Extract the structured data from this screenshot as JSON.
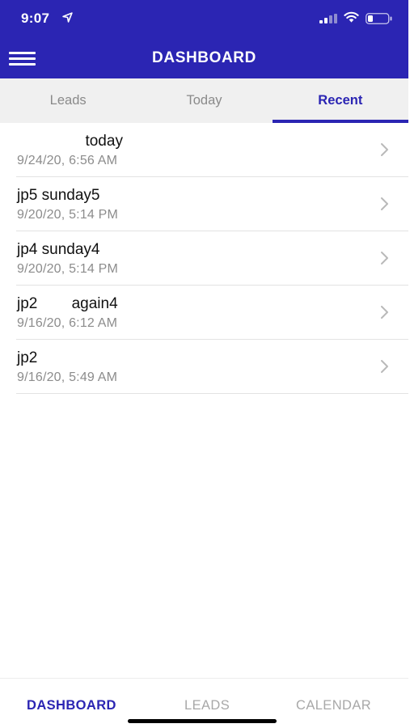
{
  "status_bar": {
    "time": "9:07",
    "icons": [
      "location-arrow-icon",
      "signal-icon",
      "wifi-icon",
      "battery-icon"
    ]
  },
  "header": {
    "title": "DASHBOARD",
    "menu_icon": "hamburger-menu-icon",
    "background_color": "#2b25b3"
  },
  "tabs": [
    {
      "label": "Leads",
      "active": false
    },
    {
      "label": "Today",
      "active": false
    },
    {
      "label": "Recent",
      "active": true
    }
  ],
  "recent_items": [
    {
      "title": "                today",
      "date": "9/24/20, 6:56 AM"
    },
    {
      "title": "jp5 sunday5",
      "date": "9/20/20, 5:14 PM"
    },
    {
      "title": "jp4 sunday4",
      "date": "9/20/20, 5:14 PM"
    },
    {
      "title": "jp2        again4",
      "date": "9/16/20, 6:12 AM"
    },
    {
      "title": "jp2",
      "date": "9/16/20, 5:49 AM"
    }
  ],
  "bottom_nav": {
    "items": [
      {
        "label": "DASHBOARD",
        "active": true
      },
      {
        "label": "LEADS",
        "active": false
      },
      {
        "label": "CALENDAR",
        "active": false
      }
    ]
  },
  "colors": {
    "accent": "#2b25b3",
    "inactive_text": "#8a8a8a",
    "tab_background": "#f0f0f0"
  }
}
